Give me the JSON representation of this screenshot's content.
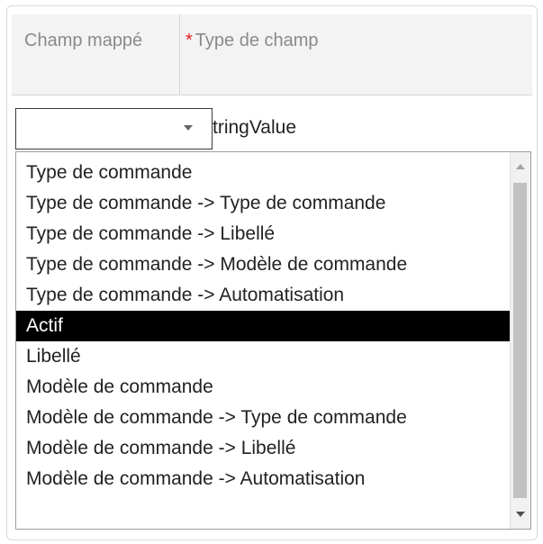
{
  "table": {
    "header": {
      "mapped_field": "Champ mappé",
      "required_marker": "*",
      "field_type": "Type de champ"
    },
    "row": {
      "field_type_value": "tringValue"
    }
  },
  "dropdown": {
    "selected_value": "",
    "highlighted_option": "Actif",
    "options": [
      "Type de commande",
      "Type de commande -> Type de commande",
      "Type de commande -> Libellé",
      "Type de commande -> Modèle de commande",
      "Type de commande -> Automatisation",
      "Actif",
      "Libellé",
      "Modèle de commande",
      "Modèle de commande -> Type de commande",
      "Modèle de commande -> Libellé",
      "Modèle de commande -> Automatisation"
    ]
  },
  "icons": {
    "select_caret": "chevron-down-icon",
    "scroll_up": "arrow-up-icon",
    "scroll_down": "arrow-down-icon"
  },
  "colors": {
    "required": "#e02020",
    "highlight_bg": "#000000",
    "highlight_fg": "#ffffff"
  }
}
